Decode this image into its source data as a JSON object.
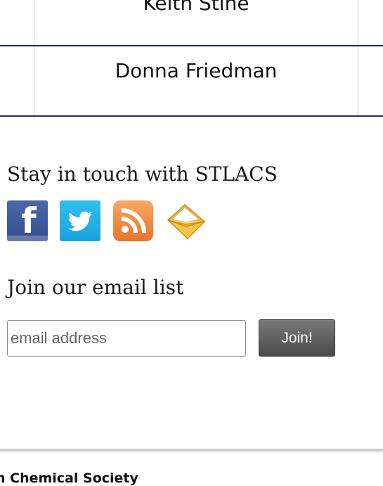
{
  "table": {
    "rows": [
      {
        "name": "Keith Stine"
      },
      {
        "name": "Donna Friedman"
      }
    ]
  },
  "social": {
    "title": "Stay in touch with STLACS",
    "icons": [
      "facebook-icon",
      "twitter-icon",
      "rss-icon",
      "email-icon"
    ],
    "facebook_glyph": "f"
  },
  "email_signup": {
    "title": "Join our email list",
    "placeholder": "email address",
    "button_label": "Join!"
  },
  "footer": {
    "text": "n Chemical Society"
  },
  "colors": {
    "table_border": "#1f2a78",
    "facebook": "#3b5998",
    "twitter": "#1da1f2",
    "rss": "#f0822e"
  }
}
